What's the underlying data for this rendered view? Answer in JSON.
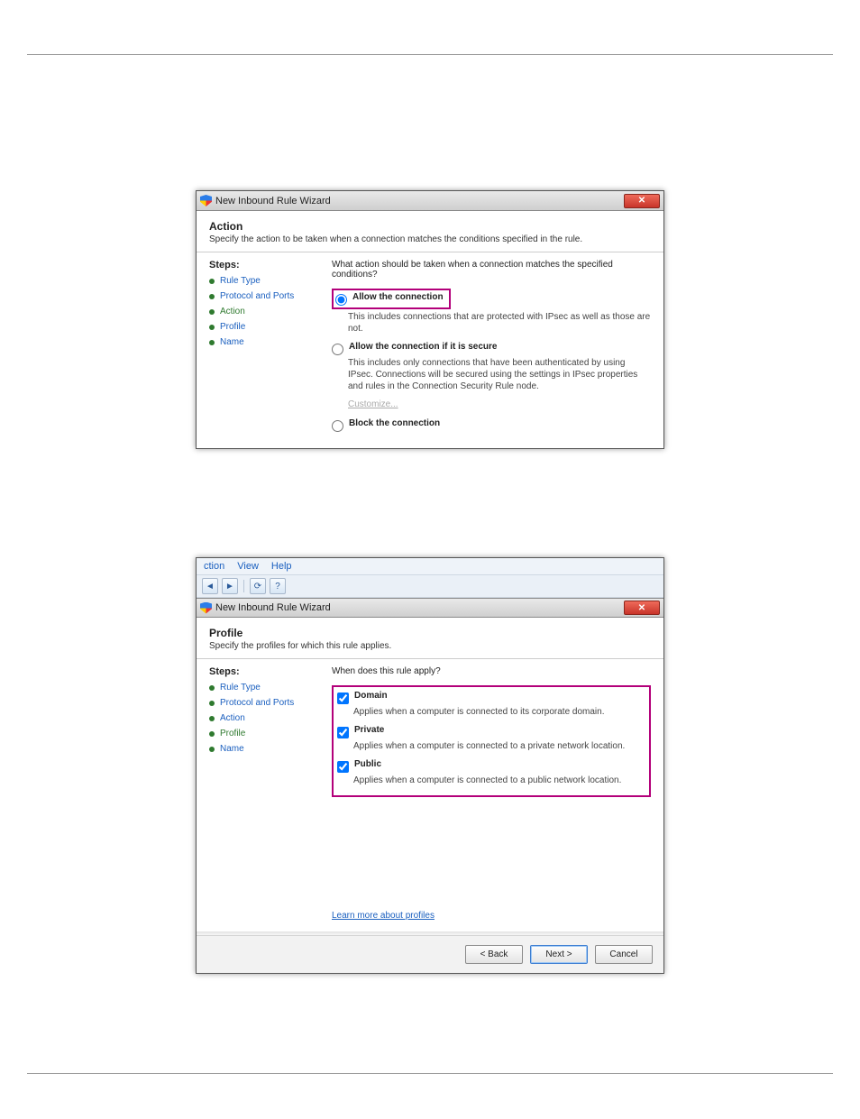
{
  "screenshot1": {
    "window_title": "New Inbound Rule Wizard",
    "heading": "Action",
    "subheading": "Specify the action to be taken when a connection matches the conditions specified in the rule.",
    "steps_title": "Steps:",
    "steps": [
      {
        "label": "Rule Type"
      },
      {
        "label": "Protocol and Ports"
      },
      {
        "label": "Action"
      },
      {
        "label": "Profile"
      },
      {
        "label": "Name"
      }
    ],
    "current_step_index": 2,
    "question": "What action should be taken when a connection matches the specified conditions?",
    "options": [
      {
        "type": "radio",
        "checked": true,
        "highlighted": true,
        "label": "Allow the connection",
        "desc": "This includes connections that are protected with IPsec as well as those are not."
      },
      {
        "type": "radio",
        "checked": false,
        "label": "Allow the connection if it is secure",
        "desc": "This includes only connections that have been authenticated by using IPsec. Connections will be secured using the settings in IPsec properties and rules in the Connection Security Rule node.",
        "customize": "Customize..."
      },
      {
        "type": "radio",
        "checked": false,
        "label": "Block the connection"
      }
    ]
  },
  "screenshot2": {
    "menu": {
      "items": [
        "ction",
        "View",
        "Help"
      ]
    },
    "toolbar_icons": [
      "back-icon",
      "forward-icon",
      "sep",
      "refresh-icon",
      "help-icon"
    ],
    "window_title": "New Inbound Rule Wizard",
    "heading": "Profile",
    "subheading": "Specify the profiles for which this rule applies.",
    "steps_title": "Steps:",
    "steps": [
      {
        "label": "Rule Type"
      },
      {
        "label": "Protocol and Ports"
      },
      {
        "label": "Action"
      },
      {
        "label": "Profile"
      },
      {
        "label": "Name"
      }
    ],
    "current_step_index": 3,
    "question": "When does this rule apply?",
    "options": [
      {
        "type": "check",
        "checked": true,
        "label": "Domain",
        "desc": "Applies when a computer is connected to its corporate domain."
      },
      {
        "type": "check",
        "checked": true,
        "label": "Private",
        "desc": "Applies when a computer is connected to a private network location."
      },
      {
        "type": "check",
        "checked": true,
        "label": "Public",
        "desc": "Applies when a computer is connected to a public network location."
      }
    ],
    "learn_more": "Learn more about profiles",
    "buttons": {
      "back": "< Back",
      "next": "Next >",
      "cancel": "Cancel"
    }
  }
}
